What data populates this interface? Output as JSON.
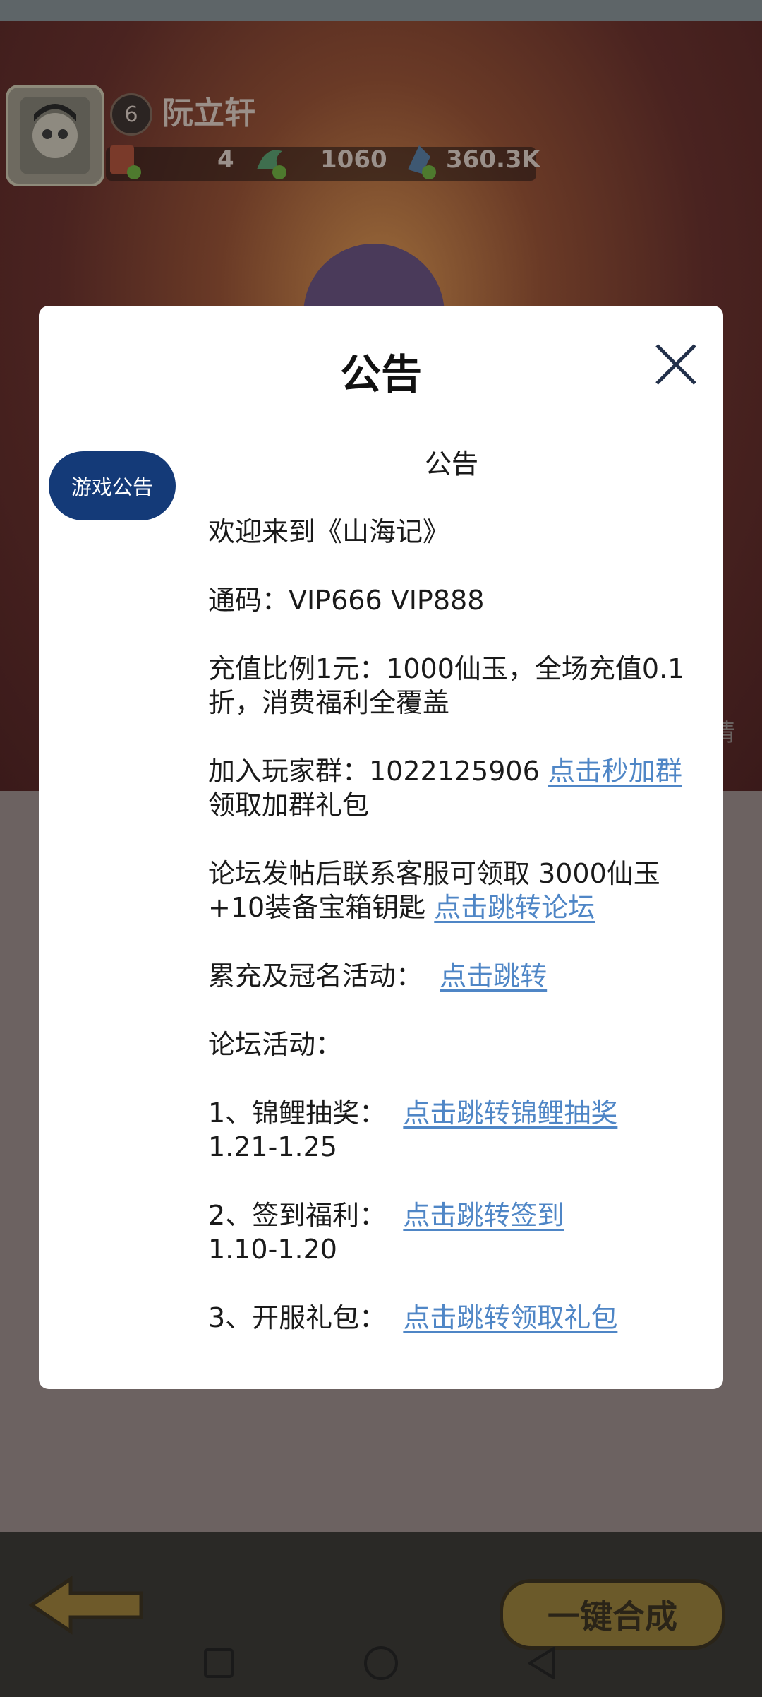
{
  "game": {
    "player": {
      "level": "6",
      "name": "阮立轩"
    },
    "currencies": [
      {
        "icon": "red-envelope-icon",
        "value": "4"
      },
      {
        "icon": "jade-dragon-icon",
        "value": "1060"
      },
      {
        "icon": "crystal-icon",
        "value": "360.3K"
      }
    ],
    "side_hint": "请",
    "merge_button": "一键合成"
  },
  "modal": {
    "title": "公告",
    "tab_label": "游戏公告",
    "heading": "公告",
    "line_welcome": "欢迎来到《山海记》",
    "line_code": "通码：VIP666 VIP888",
    "line_recharge": "充值比例1元：1000仙玉，全场充值0.1折，消费福利全覆盖",
    "group_prefix": "加入玩家群：1022125906 ",
    "group_link": "点击秒加群",
    "group_suffix": " 领取加群礼包",
    "forum_text": "论坛发帖后联系客服可领取 3000仙玉+10装备宝箱钥匙 ",
    "forum_link": "点击跳转论坛",
    "activity_label": "累充及冠名活动：  ",
    "activity_link": "点击跳转",
    "forum_activities": "论坛活动：",
    "item1_label": "1、锦鲤抽奖：  ",
    "item1_link": "点击跳转锦鲤抽奖",
    "item1_date": "1.21-1.25",
    "item2_label": "2、签到福利：  ",
    "item2_link": "点击跳转签到",
    "item2_date": "1.10-1.20",
    "item3_label": "3、开服礼包：  ",
    "item3_link": "点击跳转领取礼包"
  },
  "colors": {
    "tab_bg": "#143a78",
    "link": "#4f86c6"
  }
}
